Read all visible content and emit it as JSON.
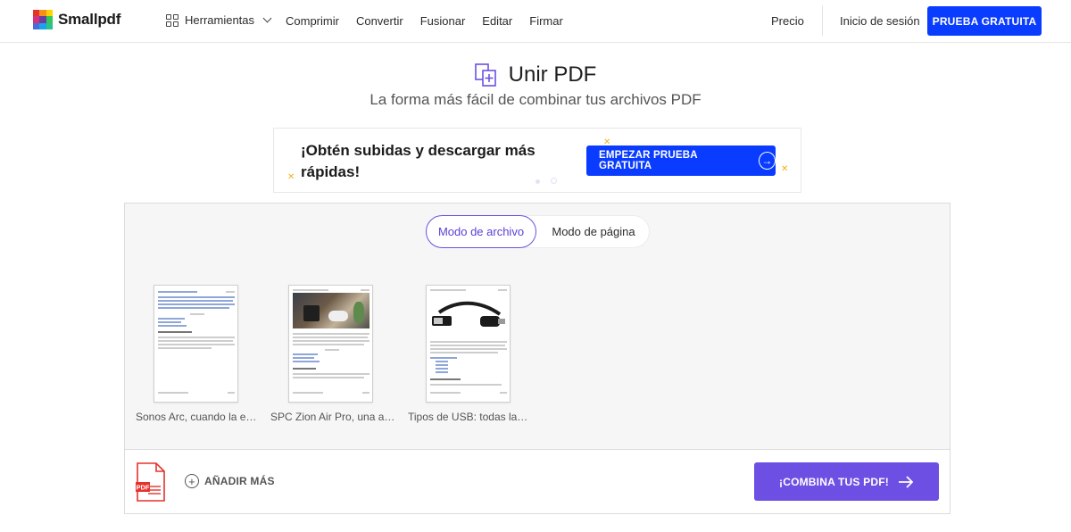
{
  "nav": {
    "brand": "Smallpdf",
    "tools_label": "Herramientas",
    "links": [
      "Comprimir",
      "Convertir",
      "Fusionar",
      "Editar",
      "Firmar"
    ],
    "pricing": "Precio",
    "login": "Inicio de sesión",
    "trial_button": "PRUEBA GRATUITA",
    "accent_color": "#0a3cff"
  },
  "header": {
    "icon": "merge-pdf-icon",
    "title": "Unir PDF",
    "subtitle": "La forma más fácil de combinar tus archivos PDF"
  },
  "promo": {
    "text": "¡Obtén subidas y descargar más rápidas!",
    "button": "EMPEZAR PRUEBA GRATUITA"
  },
  "mode_toggle": {
    "options": [
      "Modo de archivo",
      "Modo de página"
    ],
    "selected": "Modo de archivo"
  },
  "files": [
    {
      "name": "Sonos Arc, cuando la ex…",
      "thumbnail": "text-page"
    },
    {
      "name": "SPC Zion Air Pro, una alt…",
      "thumbnail": "photo-page"
    },
    {
      "name": "Tipos de USB: todas las …",
      "thumbnail": "cable-page"
    }
  ],
  "actions": {
    "add_more": "AÑADIR MÁS",
    "combine": "¡COMBINA TUS PDF!",
    "combine_color": "#6d4fe4"
  }
}
